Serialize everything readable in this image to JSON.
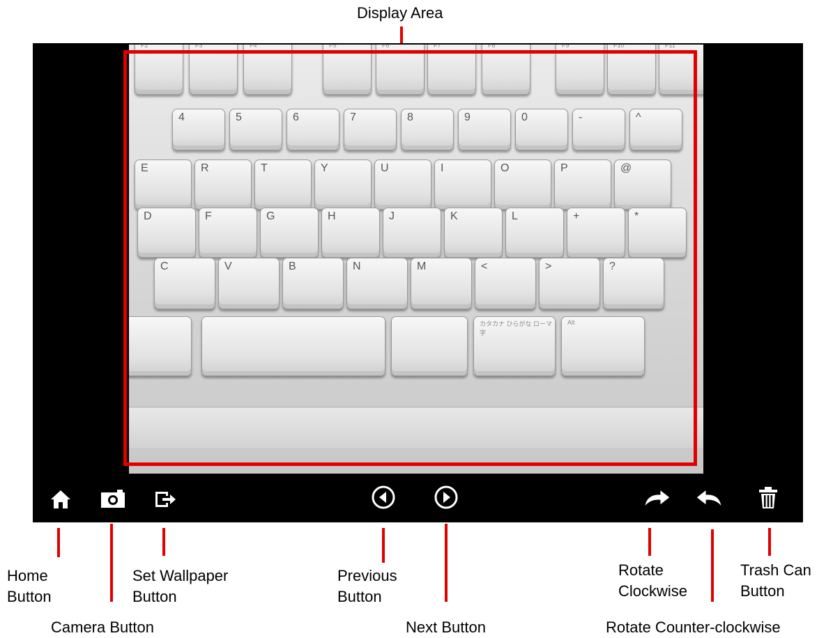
{
  "labels": {
    "display_area": "Display Area",
    "home": [
      "Home",
      "Button"
    ],
    "camera": "Camera Button",
    "set_wallpaper": [
      "Set Wallpaper",
      "Button"
    ],
    "previous": [
      "Previous",
      "Button"
    ],
    "next": "Next Button",
    "rotate_clockwise": [
      "Rotate",
      "Clockwise"
    ],
    "rotate_counter": "Rotate Counter-clockwise",
    "trash": [
      "Trash Can",
      "Button"
    ]
  },
  "toolbar": {
    "buttons": [
      "home-icon",
      "camera-icon",
      "set-wallpaper-icon",
      "previous-icon",
      "next-icon",
      "rotate-clockwise-icon",
      "rotate-counter-clockwise-icon",
      "trash-can-icon"
    ]
  },
  "keyboard": {
    "function_row": [
      "F2",
      "F3",
      "F4",
      "F5",
      "F6",
      "F7",
      "F8",
      "F9",
      "F10",
      "F11"
    ],
    "number_row": [
      "4",
      "5",
      "6",
      "7",
      "8",
      "9",
      "0",
      "-",
      "^"
    ],
    "qwerty_row": [
      "E",
      "R",
      "T",
      "Y",
      "U",
      "I",
      "O",
      "P",
      "@"
    ],
    "home_row": [
      "D",
      "F",
      "G",
      "H",
      "J",
      "K",
      "L",
      "+",
      "*"
    ],
    "bottom_row": [
      "C",
      "V",
      "B",
      "N",
      "M",
      "<",
      ">",
      "?"
    ],
    "space_row": [
      "",
      "",
      "",
      "カタカナ ひらがな ローマ字",
      "Alt"
    ]
  },
  "colors": {
    "highlight": "#e00000",
    "screen": "#000000",
    "icon": "#ffffff"
  }
}
